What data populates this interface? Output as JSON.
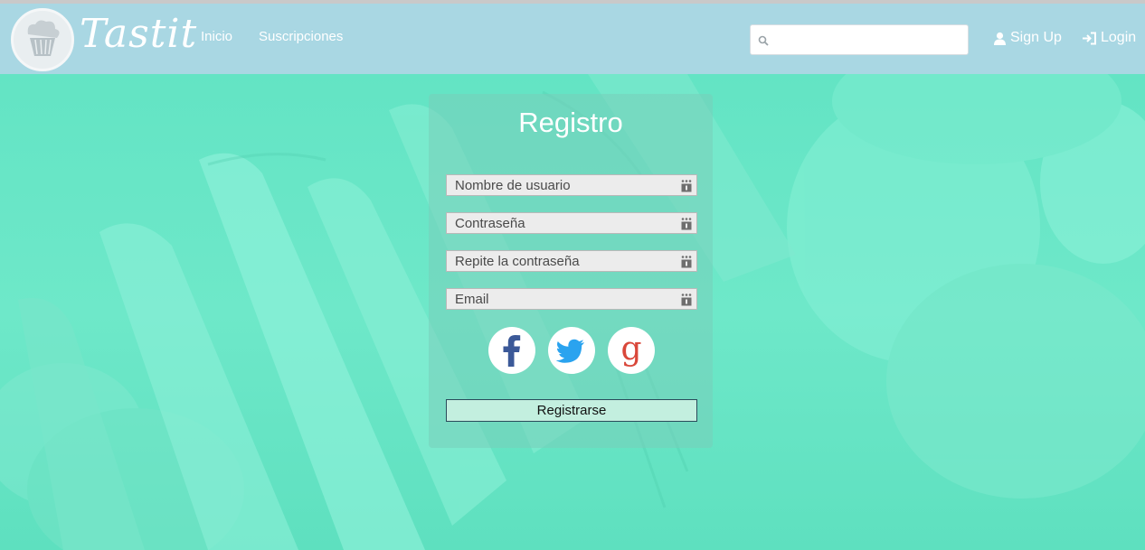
{
  "brand": {
    "name": "Tastit"
  },
  "nav": {
    "links": [
      "Inicio",
      "Suscripciones"
    ],
    "search": {
      "value": "",
      "placeholder": ""
    },
    "signup_label": "Sign Up",
    "login_label": "Login"
  },
  "form": {
    "title": "Registro",
    "fields": [
      {
        "placeholder": "Nombre de usuario",
        "value": ""
      },
      {
        "placeholder": "Contraseña",
        "value": ""
      },
      {
        "placeholder": "Repite la contraseña",
        "value": ""
      },
      {
        "placeholder": "Email",
        "value": ""
      }
    ],
    "social": [
      "facebook-icon",
      "twitter-icon",
      "google-icon"
    ],
    "submit_label": "Registrarse"
  },
  "colors": {
    "navbar": "#a9d7e3",
    "background_tint": "#6ee8c9",
    "facebook": "#3b5998",
    "twitter": "#2aa3ef",
    "google": "#d9473a"
  }
}
